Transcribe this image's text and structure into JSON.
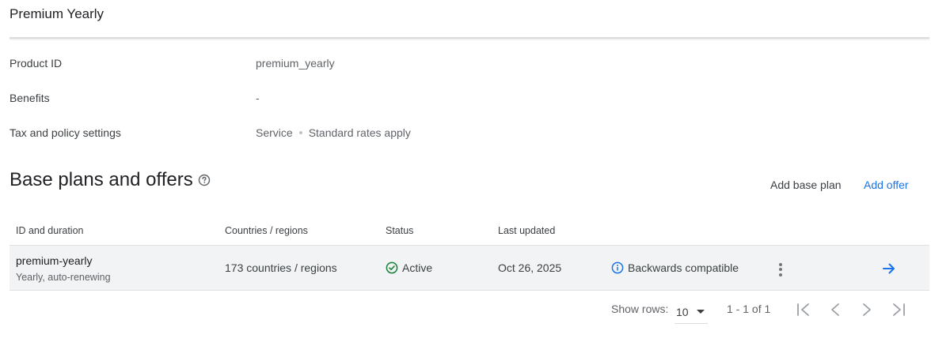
{
  "header": {
    "title": "Premium Yearly"
  },
  "details": [
    {
      "label": "Product ID",
      "value": "premium_yearly"
    },
    {
      "label": "Benefits",
      "value": "-"
    },
    {
      "label": "Tax and policy settings",
      "value_parts": [
        "Service",
        "Standard rates apply"
      ]
    }
  ],
  "section": {
    "title": "Base plans and offers",
    "actions": {
      "add_base_plan": "Add base plan",
      "add_offer": "Add offer"
    }
  },
  "table": {
    "headers": [
      "ID and duration",
      "Countries / regions",
      "Status",
      "Last updated"
    ],
    "rows": [
      {
        "id": "premium-yearly",
        "duration": "Yearly, auto-renewing",
        "countries": "173 countries / regions",
        "status": "Active",
        "last_updated": "Oct 26, 2025",
        "compatibility": "Backwards compatible"
      }
    ]
  },
  "pagination": {
    "show_rows_label": "Show rows:",
    "rows_per_page": "10",
    "range_text": "1 - 1 of 1"
  },
  "colors": {
    "accent": "#1a73e8",
    "active_green": "#188038",
    "info_blue": "#1a73e8"
  },
  "icons": [
    "help-icon",
    "check-circle-icon",
    "info-icon",
    "more-vert-icon",
    "arrow-right-icon",
    "first-page-icon",
    "prev-page-icon",
    "next-page-icon",
    "last-page-icon"
  ]
}
